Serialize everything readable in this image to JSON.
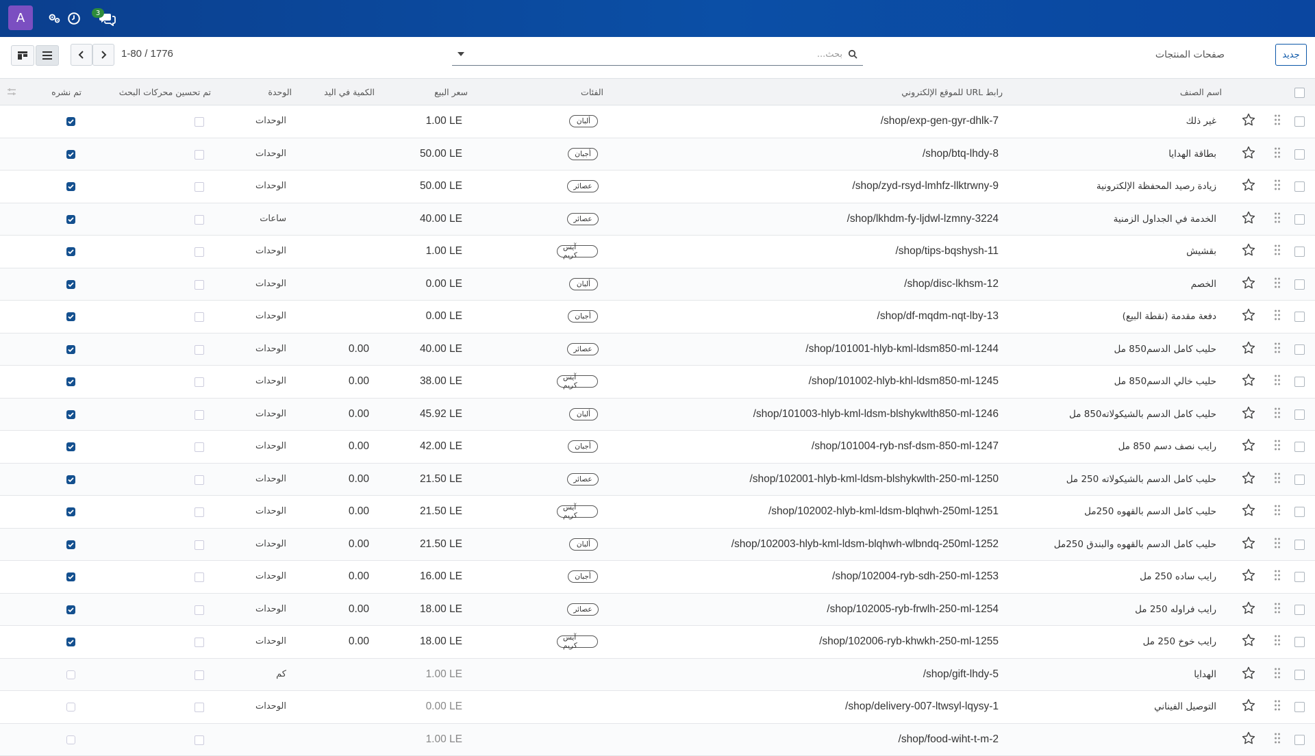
{
  "navbar": {
    "avatar_letter": "A",
    "icons": [
      "settings-icon",
      "clock-icon",
      "chat-icon"
    ],
    "chat_badge": "3",
    "bg_color": "#0b4fa6"
  },
  "control_panel": {
    "new_label": "جديد",
    "title": "صفحات المنتجات",
    "search_placeholder": "بحث...",
    "pager": "1-80 / 1776"
  },
  "columns": {
    "name": "اسم الصنف",
    "url": "رابط URL للموقع الإلكتروني",
    "categories": "الفئات",
    "sale_price": "سعر البيع",
    "qty_on_hand": "الكمية في اليد",
    "uom": "الوحدة",
    "seo_optimized": "تم تحسين محركات البحث",
    "published": "تم نشره"
  },
  "rows": [
    {
      "name": "غير ذلك",
      "url": "/shop/exp-gen-gyr-dhlk-7",
      "tag": "ألبان",
      "price": "1.00 LE",
      "qty": "",
      "uom": "الوحدات",
      "published": true
    },
    {
      "name": "بطاقة الهدايا",
      "url": "/shop/btq-lhdy-8",
      "tag": "أجبان",
      "price": "50.00 LE",
      "qty": "",
      "uom": "الوحدات",
      "published": true
    },
    {
      "name": "زيادة رصيد المحفظة الإلكترونية",
      "url": "/shop/zyd-rsyd-lmhfz-llktrwny-9",
      "tag": "عصائر",
      "price": "50.00 LE",
      "qty": "",
      "uom": "الوحدات",
      "published": true
    },
    {
      "name": "الخدمة في الجداول الزمنية",
      "url": "/shop/lkhdm-fy-ljdwl-lzmny-3224",
      "tag": "عصائر",
      "price": "40.00 LE",
      "qty": "",
      "uom": "ساعات",
      "published": true
    },
    {
      "name": "بقشيش",
      "url": "/shop/tips-bqshysh-11",
      "tag": "آيس كريم",
      "price": "1.00 LE",
      "qty": "",
      "uom": "الوحدات",
      "published": true
    },
    {
      "name": "الخصم",
      "url": "/shop/disc-lkhsm-12",
      "tag": "ألبان",
      "price": "0.00 LE",
      "qty": "",
      "uom": "الوحدات",
      "published": true
    },
    {
      "name": "دفعة مقدمة (نقطة البيع)",
      "url": "/shop/df-mqdm-nqt-lby-13",
      "tag": "أجبان",
      "price": "0.00 LE",
      "qty": "",
      "uom": "الوحدات",
      "published": true
    },
    {
      "name": "حليب كامل الدسم850 مل",
      "url": "/shop/101001-hlyb-kml-ldsm850-ml-1244",
      "tag": "عصائر",
      "price": "40.00 LE",
      "qty": "0.00",
      "uom": "الوحدات",
      "published": true
    },
    {
      "name": "حليب خالي الدسم850 مل",
      "url": "/shop/101002-hlyb-khl-ldsm850-ml-1245",
      "tag": "آيس كريم",
      "price": "38.00 LE",
      "qty": "0.00",
      "uom": "الوحدات",
      "published": true
    },
    {
      "name": "حليب كامل الدسم بالشيكولاته850 مل",
      "url": "/shop/101003-hlyb-kml-ldsm-blshykwlth850-ml-1246",
      "tag": "ألبان",
      "price": "45.92 LE",
      "qty": "0.00",
      "uom": "الوحدات",
      "published": true
    },
    {
      "name": "رايب نصف دسم 850 مل",
      "url": "/shop/101004-ryb-nsf-dsm-850-ml-1247",
      "tag": "أجبان",
      "price": "42.00 LE",
      "qty": "0.00",
      "uom": "الوحدات",
      "published": true
    },
    {
      "name": "حليب كامل الدسم بالشيكولاته 250 مل",
      "url": "/shop/102001-hlyb-kml-ldsm-blshykwlth-250-ml-1250",
      "tag": "عصائر",
      "price": "21.50 LE",
      "qty": "0.00",
      "uom": "الوحدات",
      "published": true
    },
    {
      "name": "حليب كامل الدسم بالقهوه 250مل",
      "url": "/shop/102002-hlyb-kml-ldsm-blqhwh-250ml-1251",
      "tag": "آيس كريم",
      "price": "21.50 LE",
      "qty": "0.00",
      "uom": "الوحدات",
      "published": true
    },
    {
      "name": "حليب كامل الدسم بالقهوه والبندق 250مل",
      "url": "/shop/102003-hlyb-kml-ldsm-blqhwh-wlbndq-250ml-1252",
      "tag": "ألبان",
      "price": "21.50 LE",
      "qty": "0.00",
      "uom": "الوحدات",
      "published": true
    },
    {
      "name": "رايب ساده 250 مل",
      "url": "/shop/102004-ryb-sdh-250-ml-1253",
      "tag": "أجبان",
      "price": "16.00 LE",
      "qty": "0.00",
      "uom": "الوحدات",
      "published": true
    },
    {
      "name": "رايب فراوله 250 مل",
      "url": "/shop/102005-ryb-frwlh-250-ml-1254",
      "tag": "عصائر",
      "price": "18.00 LE",
      "qty": "0.00",
      "uom": "الوحدات",
      "published": true
    },
    {
      "name": "رايب خوخ 250 مل",
      "url": "/shop/102006-ryb-khwkh-250-ml-1255",
      "tag": "آيس كريم",
      "price": "18.00 LE",
      "qty": "0.00",
      "uom": "الوحدات",
      "published": true
    },
    {
      "name": "الهدايا",
      "url": "/shop/gift-lhdy-5",
      "tag": "",
      "price": "1.00 LE",
      "qty": "",
      "uom": "كم",
      "published": false
    },
    {
      "name": "التوصيل الفيناني",
      "url": "/shop/delivery-007-ltwsyl-lqysy-1",
      "tag": "",
      "price": "0.00 LE",
      "qty": "",
      "uom": "الوحدات",
      "published": false
    },
    {
      "name": "",
      "url": "/shop/food-wiht-t-m-2",
      "tag": "",
      "price": "1.00 LE",
      "qty": "",
      "uom": "",
      "published": false
    }
  ]
}
